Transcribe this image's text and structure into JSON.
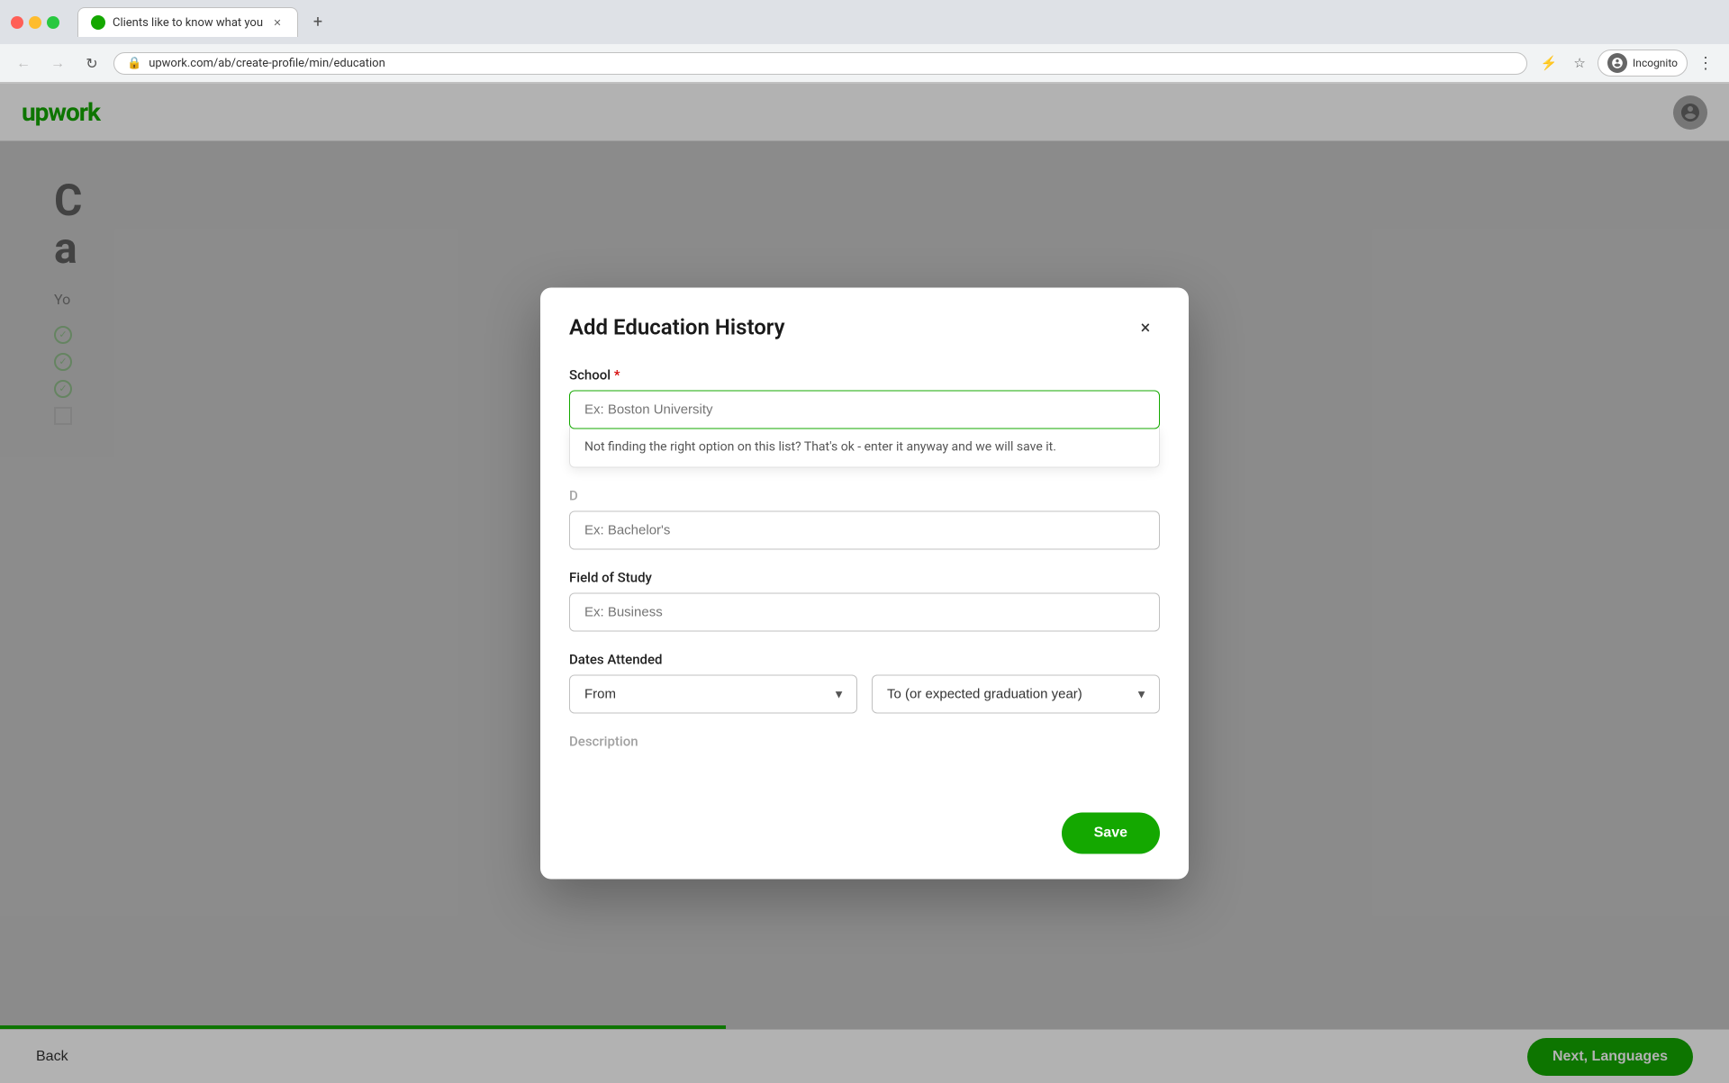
{
  "browser": {
    "tab_title": "Clients like to know what you",
    "tab_favicon": "upwork-favicon",
    "address_url": "upwork.com/ab/create-profile/min/education",
    "incognito_label": "Incognito",
    "new_tab_icon": "+",
    "back_disabled": false,
    "forward_disabled": true
  },
  "header": {
    "logo_text": "upwork",
    "avatar_icon": "user-avatar"
  },
  "background": {
    "title_line1": "C",
    "title_line2": "a",
    "body_text": "Yo"
  },
  "modal": {
    "title": "Add Education History",
    "close_icon": "×",
    "school": {
      "label": "School",
      "required": true,
      "placeholder": "Ex: Boston University",
      "dropdown_hint": "Not finding the right option on this list? That's ok - enter it anyway and we will save it."
    },
    "degree": {
      "label": "Degree",
      "placeholder": "Ex: Bachelor's"
    },
    "field_of_study": {
      "label": "Field of Study",
      "placeholder": "Ex: Business"
    },
    "dates_attended": {
      "label": "Dates Attended",
      "from_label": "From",
      "to_label": "To (or expected graduation year)"
    },
    "description": {
      "label": "Description"
    },
    "save_button": "Save"
  },
  "bottom_bar": {
    "back_label": "Back",
    "next_label": "Next, Languages",
    "progress_percent": 42
  },
  "status_bar": {
    "url": "https://www.upwork.com/ab/create-profile/"
  }
}
